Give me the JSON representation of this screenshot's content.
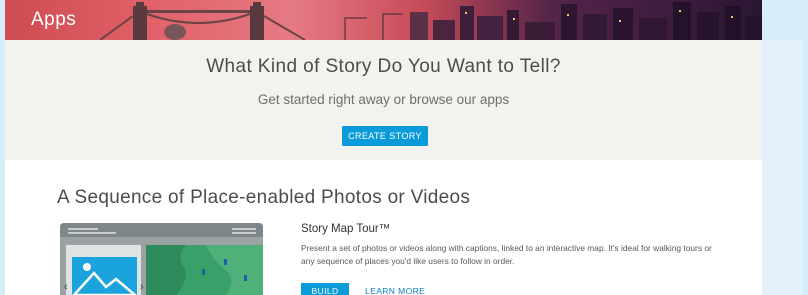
{
  "hero": {
    "title": "Apps"
  },
  "cta": {
    "heading": "What Kind of Story Do You Want to Tell?",
    "subheading": "Get started right away or browse our apps",
    "button_label": "CREATE STORY"
  },
  "section": {
    "title": "A Sequence of Place-enabled Photos or Videos",
    "item": {
      "title": "Story Map Tour™",
      "description_line1": "Present a set of photos or videos along with captions, linked to an interactive map. It's ideal for walking tours or",
      "description_line2": "any sequence of places you'd like users to follow in order.",
      "build_label": "BUILD",
      "learn_more_label": "LEARN MORE",
      "thumbnail_icons": {
        "prev": "chevron-left-icon",
        "next": "chevron-right-icon",
        "photo": "mountain-photo-icon"
      }
    }
  },
  "colors": {
    "accent": "#0a9bd8",
    "link": "#0a7fc2",
    "cta_background": "#f2f2ee",
    "frame": "#d6ecf8"
  }
}
